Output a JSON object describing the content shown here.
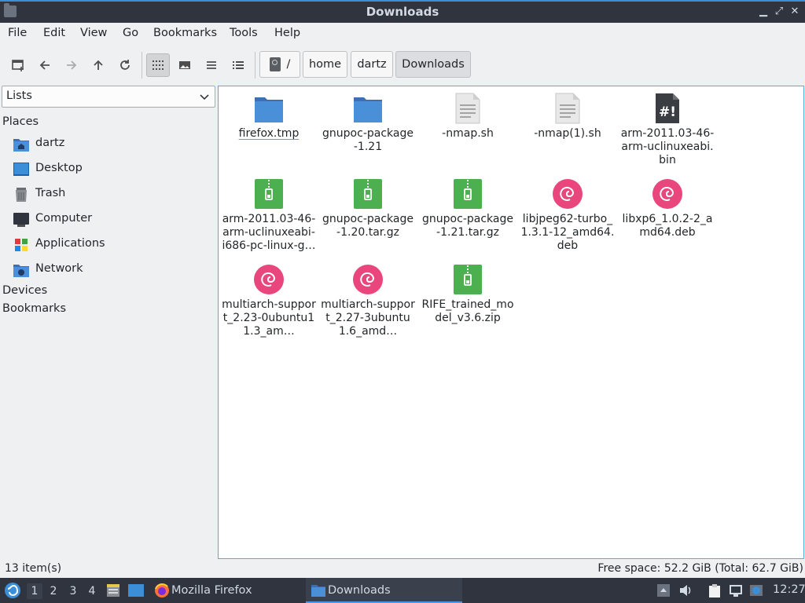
{
  "window": {
    "title": "Downloads"
  },
  "menu": [
    "File",
    "Edit",
    "View",
    "Go",
    "Bookmarks",
    "Tools",
    "Help"
  ],
  "path": {
    "root": "/",
    "segments": [
      "home",
      "dartz",
      "Downloads"
    ]
  },
  "sidebar": {
    "selector": "Lists",
    "places_heading": "Places",
    "places": [
      {
        "label": "dartz",
        "icon": "home-folder-icon"
      },
      {
        "label": "Desktop",
        "icon": "desktop-icon"
      },
      {
        "label": "Trash",
        "icon": "trash-icon"
      },
      {
        "label": "Computer",
        "icon": "computer-icon"
      },
      {
        "label": "Applications",
        "icon": "applications-icon"
      },
      {
        "label": "Network",
        "icon": "network-icon"
      }
    ],
    "devices_heading": "Devices",
    "bookmarks_heading": "Bookmarks"
  },
  "files": [
    {
      "name": "firefox.tmp",
      "type": "folder"
    },
    {
      "name": "gnupoc-package-1.21",
      "type": "folder"
    },
    {
      "name": "-nmap.sh",
      "type": "text"
    },
    {
      "name": "-nmap(1).sh",
      "type": "text"
    },
    {
      "name": "arm-2011.03-46-arm-uclinuxeabi.bin",
      "type": "script"
    },
    {
      "name": "arm-2011.03-46-arm-uclinuxeabi-i686-pc-linux-g…",
      "type": "archive"
    },
    {
      "name": "gnupoc-package-1.20.tar.gz",
      "type": "archive"
    },
    {
      "name": "gnupoc-package-1.21.tar.gz",
      "type": "archive"
    },
    {
      "name": "libjpeg62-turbo_1.3.1-12_amd64.deb",
      "type": "deb"
    },
    {
      "name": "libxp6_1.0.2-2_amd64.deb",
      "type": "deb"
    },
    {
      "name": "multiarch-support_2.23-0ubuntu11.3_am…",
      "type": "deb"
    },
    {
      "name": "multiarch-support_2.27-3ubuntu1.6_amd…",
      "type": "deb"
    },
    {
      "name": "RIFE_trained_model_v3.6.zip",
      "type": "archive"
    }
  ],
  "status": {
    "count": "13 item(s)",
    "free_space": "Free space: 52.2 GiB (Total: 62.7 GiB)"
  },
  "taskbar": {
    "workspaces": [
      "1",
      "2",
      "3",
      "4"
    ],
    "tasks": [
      {
        "label": "Mozilla Firefox",
        "icon": "firefox-icon"
      },
      {
        "label": "Downloads",
        "icon": "folder-icon"
      }
    ],
    "clock": "12:27"
  },
  "colors": {
    "accent": "#3daee9",
    "folder": "#4a90d9",
    "archive": "#4caf50",
    "deb": "#e8467c",
    "panel": "#2f343f"
  }
}
